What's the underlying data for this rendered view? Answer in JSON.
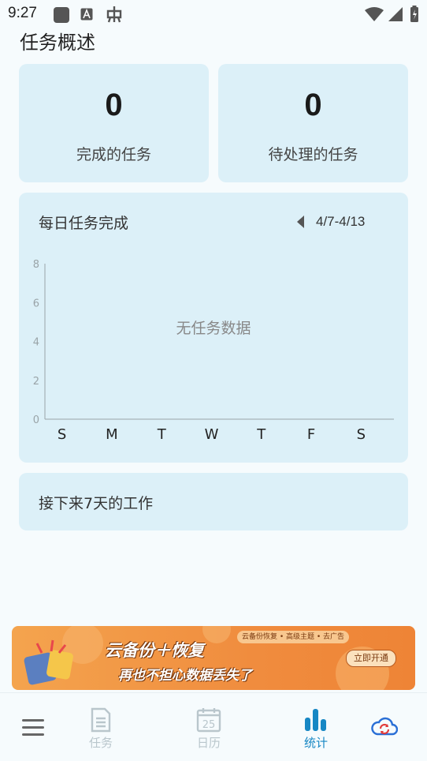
{
  "status_bar": {
    "time": "9:27"
  },
  "page": {
    "title": "任务概述"
  },
  "summary": [
    {
      "value": "0",
      "label": "完成的任务"
    },
    {
      "value": "0",
      "label": "待处理的任务"
    }
  ],
  "daily_chart": {
    "title": "每日任务完成",
    "date_range": "4/7-4/13",
    "empty_message": "无任务数据"
  },
  "chart_data": {
    "type": "bar",
    "title": "每日任务完成",
    "categories": [
      "S",
      "M",
      "T",
      "W",
      "T",
      "F",
      "S"
    ],
    "values": [],
    "y_ticks": [
      "0",
      "2",
      "4",
      "6",
      "8"
    ],
    "ylim": [
      0,
      8
    ],
    "grid": false,
    "empty_message": "无任务数据"
  },
  "upcoming": {
    "title": "接下来7天的工作"
  },
  "banner": {
    "headline": "云备份＋恢复",
    "subline": "再也不担心数据丢失了",
    "tags": "云备份恢复 • 高级主题 • 去广告",
    "cta": "立即开通"
  },
  "bottom_nav": {
    "tasks": "任务",
    "calendar": "日历",
    "calendar_day": "25",
    "stats": "统计"
  },
  "colors": {
    "card_bg": "#dcf0f8",
    "page_bg": "#f6fbfd",
    "active_tab": "#1787c4",
    "inactive_tab": "#b9c6cc",
    "banner_orange": "#f08c3e"
  }
}
